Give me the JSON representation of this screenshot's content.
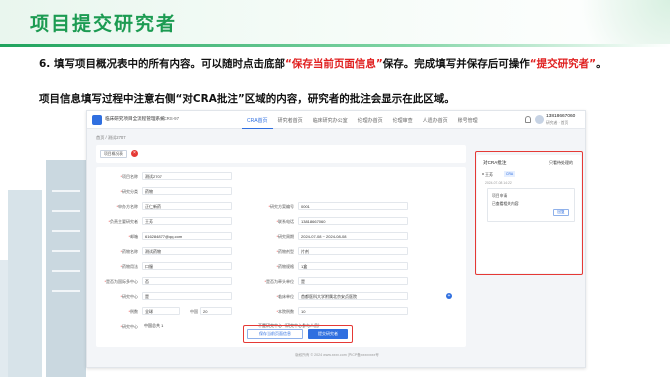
{
  "slide": {
    "title": "项目提交研究者",
    "instr1_a": "6. 填写项目概况表中的所有内容。可以随时点击底部",
    "instr1_b": "“保存当前页面信息”",
    "instr1_c": "保存。完成填写并保存后可操作",
    "instr1_d": "“提交研究者”",
    "instr1_e": "。",
    "instr2": "项目信息填写过程中注意右侧“对CRA批注”区域的内容，研究者的批注会显示在此区域。"
  },
  "app": {
    "name": "临床研究项目全流程管理系统",
    "account": "eCRS-97",
    "nav": [
      "CRA首页",
      "研究者首页",
      "临床研究办公室",
      "伦理办首页",
      "伦理审查",
      "人遗办首页",
      "账号管理"
    ],
    "user_phone": "13818667060",
    "user_role": "研究者 · 首页",
    "breadcrumb": "首页 / 测试2707",
    "review_button": "项目概况表",
    "form": [
      {
        "label": "项目名称",
        "value": "测试2707",
        "required": true
      },
      {
        "label": "研究分类",
        "value": "药物",
        "required": true
      },
      {
        "label": "申办方名称",
        "value": "正仁新药",
        "label2": "研究方案编号",
        "value2": "0001",
        "required": true
      },
      {
        "label": "负责主要研究者",
        "value": "王芳",
        "label2": "联系电话",
        "value2": "13818667060",
        "required": true
      },
      {
        "label": "邮箱",
        "value": "616284877@qq.com",
        "label2": "研究周期",
        "value2": "2024-07-08  ~  2024-08-08",
        "required": true
      },
      {
        "label": "药物名称",
        "value": "测试药物",
        "label2": "药物剂型",
        "value2": "片剂",
        "required": true
      },
      {
        "label": "药物用法",
        "value": "口服",
        "label2": "药物规格",
        "value2": "1盒",
        "required": true
      },
      {
        "label": "是否为国际多中心",
        "value": "否",
        "label2": "是否为牵头单位",
        "value2": "是",
        "required": true
      },
      {
        "label": "研究中心",
        "value": "是",
        "label2": "临床单位",
        "value2": "首都医科大学附属北京安贞医院",
        "required": true
      },
      {
        "label": "例数",
        "value": "全球",
        "mid_label": "中国",
        "mid_value": "20",
        "label2": "本院例数",
        "value2": "10",
        "required": true
      },
      {
        "label": "研究中心",
        "value": "中国总共 1",
        "label2": "",
        "value2": "不是研究中心（研究中心参与人员）",
        "required": true
      }
    ],
    "save_button": "保存当前页面信息",
    "submit_button": "提交研究者",
    "footer": "版权所有 © 2024 www.xxxx.com  沪ICP备xxxxxxxx号",
    "cra": {
      "title": "对CRA批注",
      "link": "只看待处理的",
      "item_name": "王芳",
      "tag": "CRA",
      "time": "2024-07-08 14:22",
      "box_title": "项目申请",
      "box_text": "已查看相关内容",
      "reply_button": "回复"
    }
  }
}
